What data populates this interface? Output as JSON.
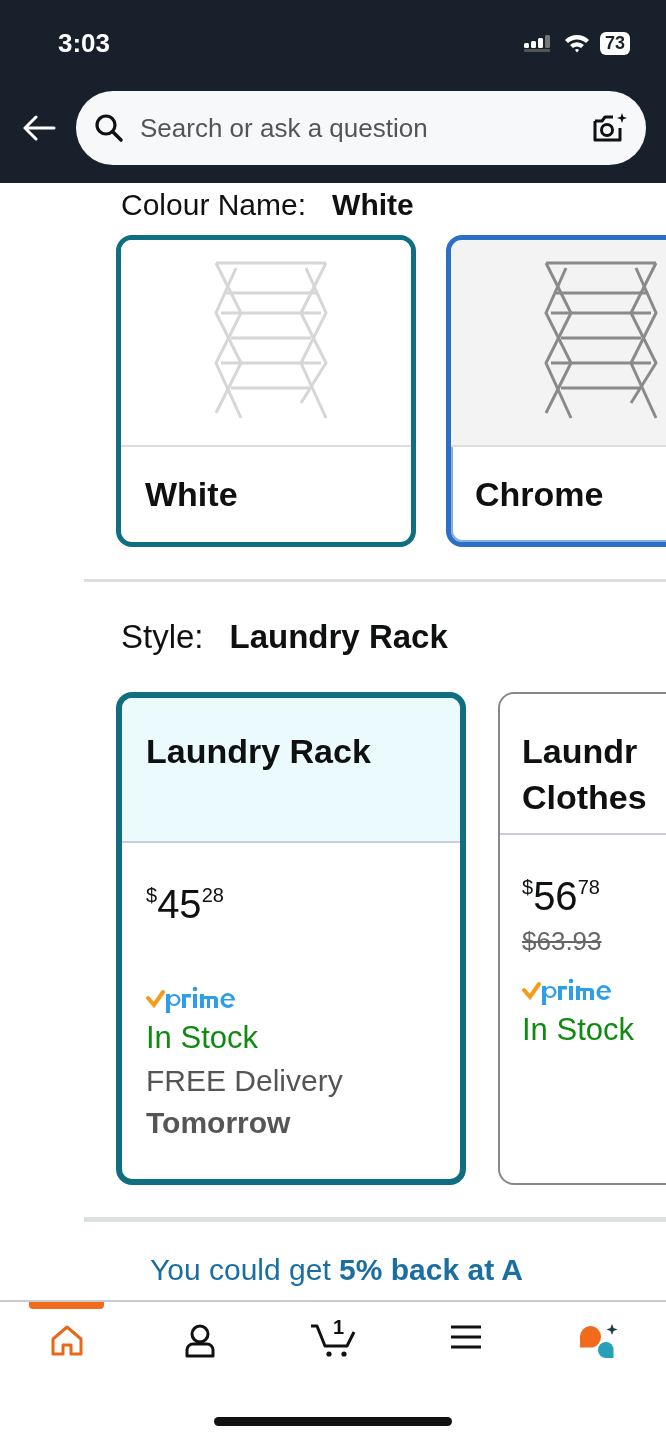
{
  "status_bar": {
    "time": "3:03",
    "battery": "73"
  },
  "search": {
    "placeholder": "Search or ask a question"
  },
  "colour": {
    "label": "Colour Name:",
    "value": "White"
  },
  "colour_options": [
    {
      "label": "White",
      "selected": true,
      "focused": false,
      "kind": "white"
    },
    {
      "label": "Chrome",
      "selected": false,
      "focused": true,
      "kind": "chrome"
    }
  ],
  "style": {
    "label": "Style:",
    "value": "Laundry Rack"
  },
  "style_options": [
    {
      "title_lines": [
        "Laundry Rack"
      ],
      "selected": true,
      "price_symbol": "$",
      "price_whole": "45",
      "price_fraction": "28",
      "prime": true,
      "stock": "In Stock",
      "delivery": "FREE Delivery",
      "delivery_day": "Tomorrow"
    },
    {
      "title_lines": [
        "Laundr",
        "Clothes"
      ],
      "selected": false,
      "price_symbol": "$",
      "price_whole": "56",
      "price_fraction": "78",
      "old_price": "$63.93",
      "prime": true,
      "stock": "In Stock"
    }
  ],
  "promo": "You could get **5% back at A**",
  "nav": [
    {
      "kind": "home",
      "selected": true
    },
    {
      "kind": "account",
      "selected": false
    },
    {
      "kind": "cart",
      "selected": false,
      "badge": "1"
    },
    {
      "kind": "menu",
      "selected": false
    },
    {
      "kind": "assistant",
      "selected": false
    }
  ]
}
